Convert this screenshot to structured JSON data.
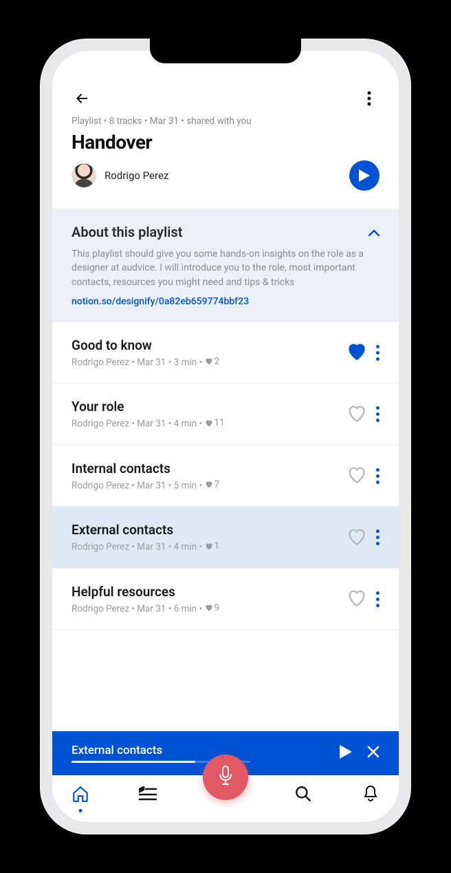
{
  "header": {
    "meta": "Playlist • 8 tracks • Mar 31 • shared with you",
    "title": "Handover",
    "author": "Rodrigo Perez"
  },
  "about": {
    "heading": "About this playlist",
    "body": "This playlist should give you some hands-on insights on the role as a designer at audvice. I will introduce you to the role, most important contacts, resources you might need and tips & tricks",
    "link": "notion.so/designify/0a82eb659774bbf23"
  },
  "tracks": [
    {
      "title": "Good to know",
      "meta": "Rodrigo Perez • Mar 31 • 3 min •  ",
      "likes": "2",
      "liked": true,
      "highlight": false
    },
    {
      "title": "Your role",
      "meta": "Rodrigo Perez • Mar 31 • 4 min •  ",
      "likes": "11",
      "liked": false,
      "highlight": false
    },
    {
      "title": "Internal contacts",
      "meta": "Rodrigo Perez • Mar 31 • 5 min •  ",
      "likes": "7",
      "liked": false,
      "highlight": false
    },
    {
      "title": "External contacts",
      "meta": "Rodrigo Perez • Mar 31 • 4 min •  ",
      "likes": "1",
      "liked": false,
      "highlight": true
    },
    {
      "title": "Helpful resources",
      "meta": "Rodrigo Perez • Mar 31 • 6 min •  ",
      "likes": "9",
      "liked": false,
      "highlight": false
    }
  ],
  "mini_player": {
    "title": "External contacts"
  }
}
